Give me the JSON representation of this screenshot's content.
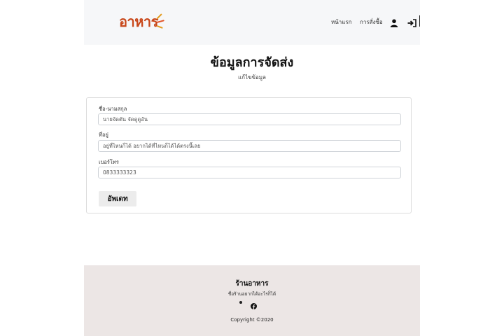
{
  "navbar": {
    "brand": "อาหาร",
    "links": [
      {
        "label": "หน้าแรก"
      },
      {
        "label": "การสั่งซื้อ"
      }
    ],
    "icons": [
      "user-icon",
      "sign-in-icon"
    ]
  },
  "page": {
    "title": "ข้อมูลการจัดส่ง",
    "subtitle": "แก้ไขข้อมูล"
  },
  "form": {
    "name_label": "ชื่อ-นามสกุล",
    "name_value": "นายจัดตัน จัดดูดูอัน",
    "address_label": "ที่อยู่",
    "address_value": "อยู่ที่ไหนก็ได้ อยากได้ที่ไหนก็ได้ได้ตรงนี้เลย",
    "phone_label": "เบอร์โทร",
    "phone_value": "0833333323",
    "update_label": "อัพเดท"
  },
  "footer": {
    "title": "ร้านอาหาร",
    "tagline": "ชื่อร้านอยากได้อะไรก็ได้",
    "copyright": "Copyright ©2020",
    "icons": [
      "dot-icon",
      "facebook-icon"
    ]
  },
  "colors": {
    "brand": "#c8471a",
    "brand_accent": "#e39b1f",
    "navbar_bg": "#f6f7f9",
    "footer_bg": "#ece6e5"
  }
}
